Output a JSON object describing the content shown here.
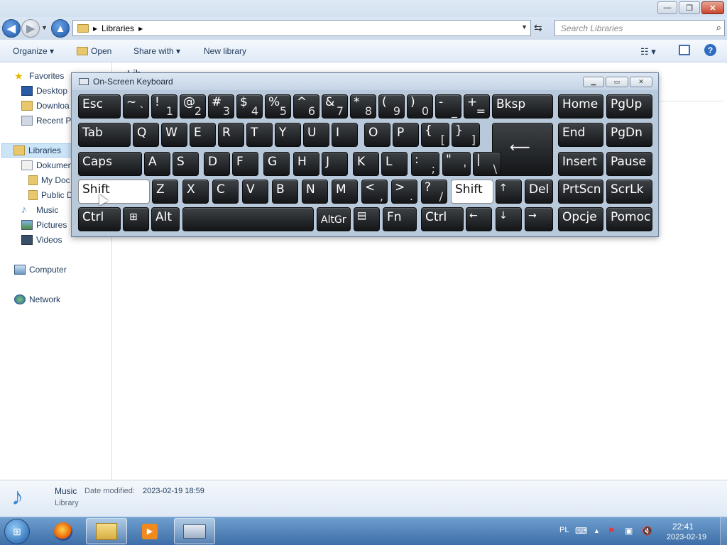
{
  "titlebar": {
    "min": "—",
    "max": "❐",
    "close": "✕"
  },
  "address": {
    "path": "Libraries",
    "sep": "▸"
  },
  "search": {
    "placeholder": "Search Libraries"
  },
  "commands": {
    "organize": "Organize ▾",
    "open": "Open",
    "share": "Share with ▾",
    "new_library": "New library"
  },
  "sidebar": {
    "favorites": "Favorites",
    "desktop": "Desktop",
    "downloads": "Downloa",
    "recent": "Recent Pl",
    "libraries": "Libraries",
    "documents": "Dokumen",
    "my_docs": "My Doc",
    "public_docs": "Public D",
    "music": "Music",
    "pictures": "Pictures",
    "videos": "Videos",
    "computer": "Computer",
    "network": "Network"
  },
  "main": {
    "heading_stub": "Lib"
  },
  "details": {
    "name": "Music",
    "date_label": "Date modified:",
    "date": "2023-02-19 18:59",
    "type": "Library"
  },
  "taskbar": {
    "lang": "PL",
    "time": "22:41",
    "date": "2023-02-19"
  },
  "osk": {
    "title": "On-Screen Keyboard",
    "keys": {
      "esc": "Esc",
      "tilde": "~",
      "tilde_b": "`",
      "k1": "!",
      "k1b": "1",
      "k2": "@",
      "k2b": "2",
      "k3": "#",
      "k3b": "3",
      "k4": "$",
      "k4b": "4",
      "k5": "%",
      "k5b": "5",
      "k6": "^",
      "k6b": "6",
      "k7": "&",
      "k7b": "7",
      "k8": "*",
      "k8b": "8",
      "k9": "(",
      "k9b": "9",
      "k0": ")",
      "k0b": "0",
      "minus": "_",
      "minus_b": "-",
      "plus": "+",
      "plus_b": "=",
      "bksp": "Bksp",
      "home": "Home",
      "pgup": "PgUp",
      "tab": "Tab",
      "q": "Q",
      "w": "W",
      "e": "E",
      "r": "R",
      "t": "T",
      "y": "Y",
      "u": "U",
      "i": "I",
      "o": "O",
      "p": "P",
      "lbr": "{",
      "lbr_b": "[",
      "rbr": "}",
      "rbr_b": "]",
      "end": "End",
      "pgdn": "PgDn",
      "caps": "Caps",
      "a": "A",
      "s": "S",
      "d": "D",
      "f": "F",
      "g": "G",
      "h": "H",
      "j": "J",
      "k": "K",
      "l": "L",
      "semi": ":",
      "semi_b": ";",
      "quote": "\"",
      "quote_b": "'",
      "pipe": "|",
      "pipe_b": "\\",
      "enter": "⟵",
      "insert": "Insert",
      "pause": "Pause",
      "lshift": "Shift",
      "z": "Z",
      "x": "X",
      "c": "C",
      "v": "V",
      "b": "B",
      "n": "N",
      "m": "M",
      "lt": "<",
      "lt_b": ",",
      "gt": ">",
      "gt_b": ".",
      "q_mark": "?",
      "q_mark_b": "/",
      "rshift": "Shift",
      "up": "↑",
      "del": "Del",
      "prtscn": "PrtScn",
      "scrlk": "ScrLk",
      "lctrl": "Ctrl",
      "win": "⊞",
      "alt": "Alt",
      "space": "",
      "altgr": "AltGr",
      "menu": "▤",
      "fn": "Fn",
      "rctrl": "Ctrl",
      "left": "←",
      "down": "↓",
      "right": "→",
      "options": "Opcje",
      "help": "Pomoc"
    }
  }
}
